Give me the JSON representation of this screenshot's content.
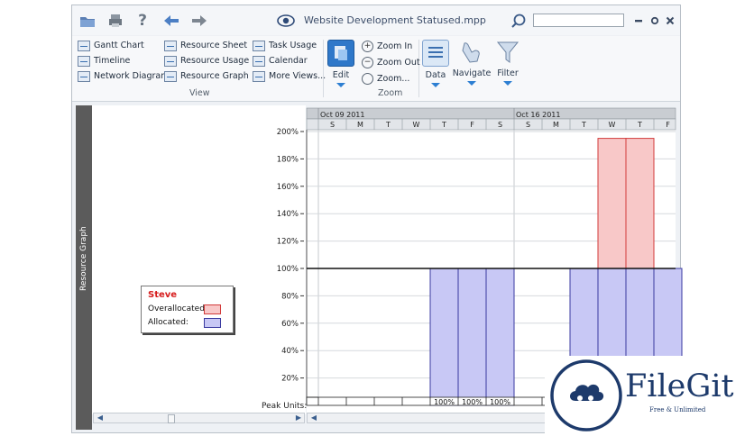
{
  "titlebar": {
    "file_name": "Website Development Statused.mpp",
    "icons": [
      "folder-open-icon",
      "print-icon",
      "help-icon",
      "back-arrow-icon",
      "forward-arrow-icon",
      "eye-icon",
      "search-icon",
      "minimize-icon",
      "restore-icon",
      "close-icon"
    ],
    "search_value": ""
  },
  "ribbon": {
    "view_group": {
      "label": "View",
      "col1": [
        "Gantt Chart",
        "Timeline",
        "Network Diagram"
      ],
      "col2": [
        "Resource Sheet",
        "Resource Usage",
        "Resource Graph"
      ],
      "col3": [
        "Task Usage",
        "Calendar",
        "More Views..."
      ]
    },
    "edit_label": "Edit",
    "zoom_group": {
      "label": "Zoom",
      "items": [
        "Zoom In",
        "Zoom Out",
        "Zoom..."
      ]
    },
    "data_label": "Data",
    "navigate_label": "Navigate",
    "filter_label": "Filter"
  },
  "sidebar": {
    "label": "Resource Graph"
  },
  "legend": {
    "resource_name": "Steve",
    "overallocated_label": "Overallocated:",
    "allocated_label": "Allocated:",
    "overallocated_color": "#f8c8c8",
    "allocated_color": "#c8c8f5"
  },
  "peak_units_label": "Peak Units:",
  "timescale": {
    "weeks": [
      "Oct 09 2011",
      "Oct 16 2011"
    ],
    "days": [
      "S",
      "M",
      "T",
      "W",
      "T",
      "F",
      "S",
      "S",
      "M",
      "T",
      "W",
      "T",
      "F"
    ]
  },
  "chart_data": {
    "type": "bar",
    "y_ticks": [
      "200%",
      "180%",
      "160%",
      "140%",
      "120%",
      "100%",
      "80%",
      "60%",
      "40%",
      "20%"
    ],
    "ylim": [
      0,
      200
    ],
    "threshold": 100,
    "series": [
      {
        "name": "Allocated:",
        "values": [
          0,
          0,
          0,
          0,
          100,
          100,
          100,
          0,
          0,
          100,
          100,
          100,
          100
        ]
      },
      {
        "name": "Overallocated:",
        "values": [
          0,
          0,
          0,
          0,
          0,
          0,
          0,
          0,
          0,
          0,
          95,
          95,
          0
        ]
      }
    ],
    "peak_units": [
      "",
      "",
      "",
      "",
      "100%",
      "100%",
      "100%",
      "",
      "",
      "",
      "",
      "",
      ""
    ]
  },
  "watermark": {
    "brand": "FileGit",
    "tagline": "Free & Unlimited"
  }
}
